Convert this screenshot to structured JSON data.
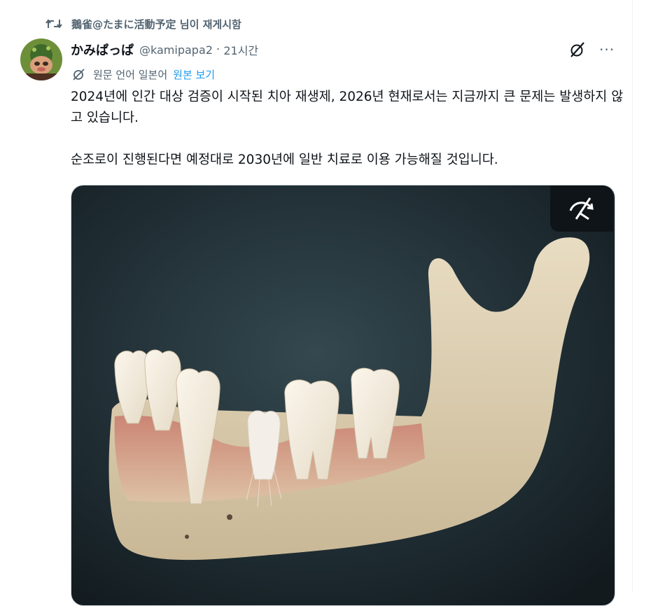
{
  "repost": {
    "text": "鵝雀@たまに活動予定 님이 재게시함",
    "icon": "repost-icon"
  },
  "author": {
    "display_name": "かみぱっぱ",
    "handle": "@kamipapa2",
    "separator": "·",
    "time": "21시간",
    "avatar_icon": "avatar"
  },
  "actions": {
    "grok_icon": "grok-icon",
    "more_label": "···"
  },
  "translation": {
    "label": "원문 언어 일본어",
    "show_original": "원본 보기",
    "icon": "translate-icon"
  },
  "tweet": {
    "line1": "2024년에 인간 대상 검증이 시작된 치아 재생제, 2026년 현재로서는 지금까지 큰 문제는 발생하지 않고 있습니다.",
    "line2": "순조로이 진행된다면 예정대로 2030년에 일반 치료로 이용 가능해질 것입니다."
  },
  "media": {
    "badge_icon": "media-ai-badge-icon",
    "image_subject": "jaw-with-regrowing-tooth-image"
  },
  "colors": {
    "text": "#0f1419",
    "secondary": "#536471",
    "link": "#1d9bf0"
  }
}
